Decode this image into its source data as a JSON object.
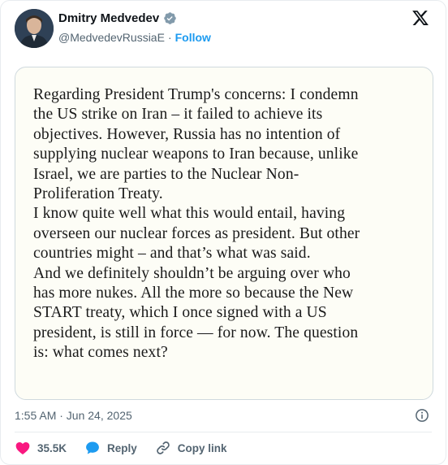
{
  "author": {
    "name": "Dmitry Medvedev",
    "handle": "@MedvedevRussiaE",
    "separator": "·",
    "follow_label": "Follow"
  },
  "image_text": "Regarding President Trump's concerns: I condemn\nthe US strike on Iran – it failed to achieve its\nobjectives. However, Russia has no intention of\nsupplying nuclear weapons to Iran because, unlike\nIsrael, we are parties to the Nuclear Non-\nProliferation Treaty.\nI know quite well what this would entail, having\noverseen our nuclear forces as president. But other\ncountries might – and that’s what was said.\nAnd we definitely shouldn’t be arguing over who\nhas more nukes. All the more so because the New\nSTART treaty, which I once signed with a US\npresident, is still in force — for now. The question\nis: what comes next?",
  "timestamp": "1:55 AM · Jun 24, 2025",
  "actions": {
    "likes": "35.5K",
    "reply_label": "Reply",
    "copy_link_label": "Copy link"
  },
  "colors": {
    "like": "#f91880",
    "reply": "#1d9bf0",
    "link": "#1d9bf0",
    "verified": "#829aab"
  },
  "icons": [
    "verified-badge-icon",
    "x-logo-icon",
    "info-icon",
    "heart-icon",
    "reply-bubble-icon",
    "link-icon"
  ]
}
